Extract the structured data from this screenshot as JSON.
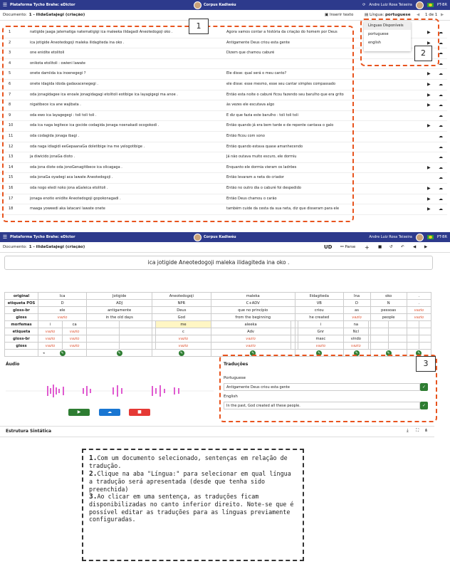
{
  "app": {
    "title": "Plataforma Tycho Brahe: eDictor",
    "corpus": "Corpus Kadiwéu",
    "user": "Andre Luiz Rosa Teixeira",
    "version": "PT-BR"
  },
  "doc": {
    "label": "Documento:",
    "name": "1 - ilidaGatajegi (criação)",
    "insert_text": "Inserir texto",
    "lingua_label": "Língua:",
    "lingua_value": "portuguese",
    "pager": "1 de 1"
  },
  "dropdown": {
    "header": "Línguas Disponíveis",
    "options": [
      "portuguese",
      "english"
    ]
  },
  "sentences": [
    {
      "n": "1",
      "o": "natigide jaaga jatematiga natematigigi ica maleeka ilidagadi Aneotedoɡoji oko .",
      "t": "Agora vamos contar a história da criação do homem por Deus"
    },
    {
      "n": "2",
      "o": "ica jotigide Aneotedoɡoji maleka ilidagiteda ina oko .",
      "t": "Antigamente Deus criou esta gente"
    },
    {
      "n": "3",
      "o": "one enidite etolitoli",
      "t": "Dizem que chamou caburé"
    },
    {
      "n": "4",
      "o": "onikota etolitoli : owieni lawate",
      "t": ""
    },
    {
      "n": "5",
      "o": "onete damiida ica inoenegegi ?",
      "t": "Ele disse: qual será o meu canto?"
    },
    {
      "n": "6",
      "o": "onete idagida idoda gadaxacenegegi .",
      "t": "ele disse: esse mesmo, esse seu cantar simples compassado"
    },
    {
      "n": "7",
      "o": "oda jonagidagee ica enoale jonagidagagi etolitoli eotibige ica layagigegi ma anoe .",
      "t": "Então esta noite o caburé ficou fazendo seu barulho que era grito"
    },
    {
      "n": "8",
      "o": "nigatibece ica ane wajibata .",
      "t": "às vezes ele escutava algo"
    },
    {
      "n": "9",
      "o": "oda ewo ica layagegegi : toli toli toli .",
      "t": "E diz que fazia este barulho : toli toli toli"
    },
    {
      "n": "10",
      "o": "oda ica naga legitece ica gocide codagida jonaga noenakadi ocogokodi .",
      "t": "Então quando já era bem tarde e de repente cantava o galo"
    },
    {
      "n": "11",
      "o": "oda codagida jonaga ibagi .",
      "t": "Então ficou com sono"
    },
    {
      "n": "12",
      "o": "oda naga idiagidi eeGepaanaGa doletibige ina me yelogotibige .",
      "t": "Então quando estava quase amanhecendo"
    },
    {
      "n": "13",
      "o": "ja diwicido jonaGa dioto .",
      "t": "Já não outava muito escuro, ele dormiu"
    },
    {
      "n": "14",
      "o": "oda jona diote oda jonoGenagitibece ica olicagaga .",
      "t": "Enquanto ele dormia vieram os ladrões"
    },
    {
      "n": "15",
      "o": "oda jonaGa oyadegi aca lawate Aneotedoɡoji .",
      "t": "Então levaram a neta do criador"
    },
    {
      "n": "16",
      "o": "oda nogo eledi noko jona aGaleica etolitoli .",
      "t": "Então no outro dia o caburé foi despedido"
    },
    {
      "n": "17",
      "o": "jonaga enotio enidite Aneotedoɡoji gopokonagadi .",
      "t": "Então Deus chamou o carão"
    },
    {
      "n": "18",
      "o": "maaga yoweedi aka latacani lawate onete",
      "t": "também cuide da cesta da sua neta, diz que disseram para ele"
    }
  ],
  "callouts": [
    "1",
    "2",
    "3"
  ],
  "editor": {
    "sentence": "ica jotigide Aneotedoɡoji maleka ilidagiteda ina oko .",
    "toolbar": {
      "ud": "UD",
      "parse": "Parse"
    },
    "row_labels": [
      "original",
      "etiqueta POS",
      "gloss-br",
      "gloss",
      "morfemas",
      "etiqueta",
      "gloss-br",
      "gloss"
    ],
    "words": [
      {
        "original": "Ica",
        "pos": "D",
        "gloss_br": "ele",
        "gloss": "vazio"
      },
      {
        "original": "Jotigide",
        "pos": "ADJ",
        "gloss_br": "antigamente",
        "gloss": "in the old days"
      },
      {
        "original": "Aneotedoɡoji",
        "pos": "NPR",
        "gloss_br": "Deus",
        "gloss": "God"
      },
      {
        "original": "maleka",
        "pos": "C+ADV",
        "gloss_br": "que no princípio",
        "gloss": "from the beginning"
      },
      {
        "original": "Ilidagiteda",
        "pos": "VB",
        "gloss_br": "criou",
        "gloss": "he created"
      },
      {
        "original": "Ina",
        "pos": "D",
        "gloss_br": "as",
        "gloss": "vazio"
      },
      {
        "original": "oko",
        "pos": "N",
        "gloss_br": "pessoas",
        "gloss": "people"
      },
      {
        "original": ".",
        "pos": ".",
        "gloss_br": "vazio",
        "gloss": "vazio"
      }
    ],
    "morph_cells": [
      "i",
      "ca",
      "",
      "",
      "",
      "me",
      "aleeka",
      "",
      "",
      "i",
      "na",
      "",
      "",
      "",
      ""
    ],
    "etiq_cells": [
      "vazio",
      "vazio",
      "",
      "",
      "",
      "c",
      "Adv",
      "",
      "",
      "Gnr",
      "Ncl",
      "",
      "",
      "",
      ""
    ],
    "gbr_cells": [
      "vazio",
      "vazio",
      "",
      "",
      "",
      "vazio",
      "vazio",
      "",
      "",
      "masc",
      "vindo",
      "",
      "",
      "",
      ""
    ],
    "gloss_cells": [
      "vazio",
      "vazio",
      "",
      "",
      "",
      "vazio",
      "vazio",
      "",
      "",
      "vazio",
      "vazio",
      "",
      "",
      "",
      ""
    ],
    "vazio": "vazio",
    "audio_title": "Áudio",
    "translations_title": "Traduções",
    "translations": [
      {
        "lang": "Portuguese",
        "text": "Antigamente Deus criou esta gente"
      },
      {
        "lang": "English",
        "text": "In the past, God created all these people."
      }
    ],
    "syntax_title": "Estrutura Sintática"
  },
  "note": {
    "n1": "1.",
    "t1": "Com um documento selecionado, sentenças em relação de tradução.",
    "n2": "2.",
    "t2": "Clique na aba \"Língua:\" para selecionar em qual língua a tradução será apresentada (desde que tenha sido preenchida)",
    "n3": "3.",
    "t3": "Ao clicar em uma sentença, as traduções ficam disponibilizadas no canto inferior direito. Note-se que é possível editar as traduções para as línguas previamente configuradas."
  }
}
